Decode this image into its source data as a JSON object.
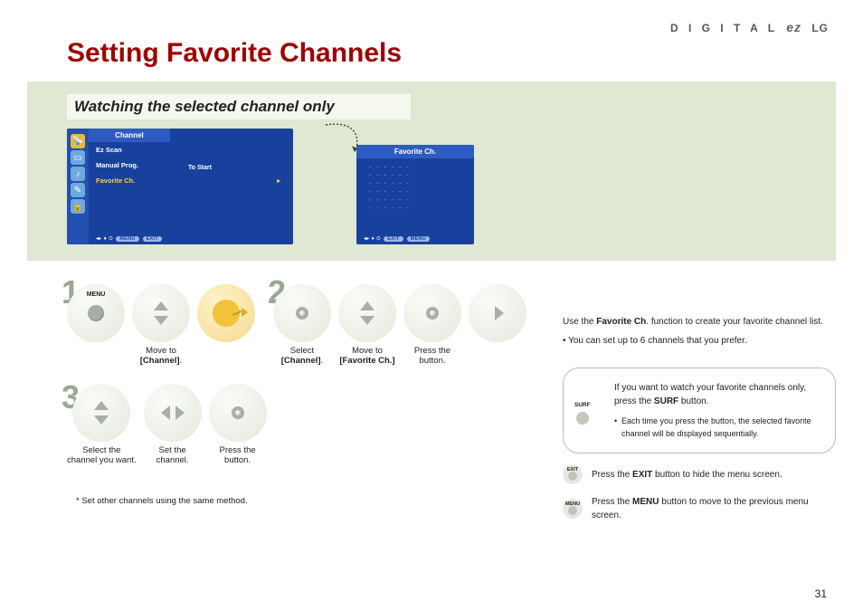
{
  "brand": {
    "digital": "D I G I T A L",
    "ez": "ez",
    "lg": "LG"
  },
  "title": "Setting Favorite Channels",
  "subheading": "Watching the selected channel only",
  "tv1": {
    "header": "Channel",
    "items": [
      "Ez Scan",
      "Manual Prog.",
      "Favorite Ch."
    ],
    "right_label": "To Start",
    "footer_menu": "MENU",
    "footer_exit": "EXIT"
  },
  "tv2": {
    "header": "Favorite Ch.",
    "dash_row": "- - - - - -",
    "footer_exit": "EXIT",
    "footer_menu": "MENU"
  },
  "steps": {
    "n1": "1",
    "n2": "2",
    "n3": "3",
    "menu_label": "MENU",
    "row1": {
      "c1": {
        "pre": "Move to",
        "bold": "[Channel]",
        "post": "."
      }
    },
    "row2": {
      "c1": {
        "pre": "Select",
        "bold": "[Channel]",
        "post": "."
      },
      "c2": {
        "pre": "Move to",
        "bold": "[Favorite Ch.]"
      },
      "c3": {
        "pre": "Press the",
        "post": "button."
      }
    },
    "row3": {
      "c1": "Select the\nchannel you want.",
      "c2": "Set the\nchannel.",
      "c3": "Press the\nbutton."
    },
    "footnote": "* Set other channels using the same method."
  },
  "right": {
    "intro_pre": "Use the ",
    "intro_bold": "Favorite Ch",
    "intro_post": ". function to create your favorite channel list.",
    "intro_line2": "• You can set up to 6 channels that you prefer.",
    "box": {
      "surf_label": "SURF",
      "line1_pre": "If you want to watch your favorite channels only, press the ",
      "line1_bold": "SURF",
      "line1_post": " button.",
      "bullet": "Each time you press the button, the selected favorite channel will be displayed sequentially."
    },
    "exit": {
      "label": "EXIT",
      "text_pre": "Press the ",
      "text_bold": "EXIT",
      "text_post": " button to hide the menu screen."
    },
    "menu": {
      "label": "MENU",
      "text_pre": "Press the ",
      "text_bold": "MENU",
      "text_post": " button to move to the previous menu screen."
    }
  },
  "page_number": "31"
}
